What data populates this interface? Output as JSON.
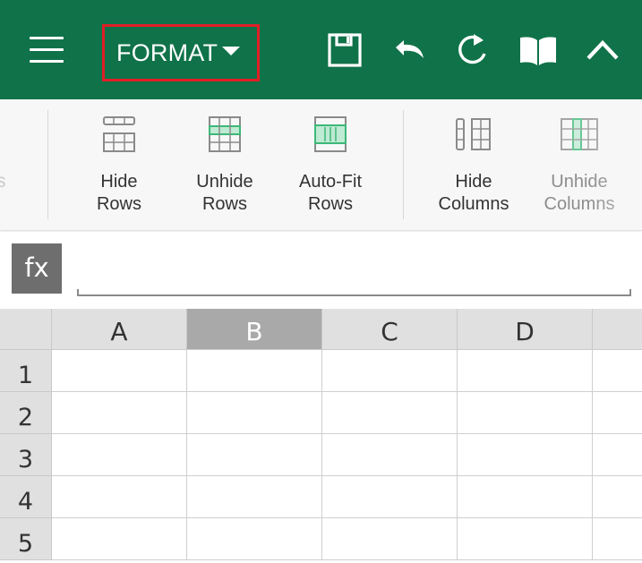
{
  "appbar": {
    "menu_icon": "hamburger-menu-icon",
    "format_label": "FORMAT",
    "format_caret_icon": "caret-down-icon",
    "actions": [
      {
        "name": "save-icon"
      },
      {
        "name": "undo-icon"
      },
      {
        "name": "redo-icon"
      },
      {
        "name": "reading-view-icon"
      },
      {
        "name": "collapse-ribbon-icon"
      }
    ],
    "bar_color": "#107249",
    "highlight_color": "#e01e26"
  },
  "ribbon": {
    "clipped_left_text": "s",
    "buttons": [
      {
        "label_line1": "Hide",
        "label_line2": "Rows",
        "icon": "hide-rows-icon"
      },
      {
        "label_line1": "Unhide",
        "label_line2": "Rows",
        "icon": "unhide-rows-icon"
      },
      {
        "label_line1": "Auto-Fit",
        "label_line2": "Rows",
        "icon": "autofit-rows-icon"
      },
      {
        "label_line1": "Hide",
        "label_line2": "Columns",
        "icon": "hide-columns-icon"
      },
      {
        "label_line1": "Unhide",
        "label_line2": "Columns",
        "icon": "unhide-columns-icon"
      }
    ],
    "icon_accent": "#3cb878"
  },
  "formula_bar": {
    "fx_label": "fx",
    "value": ""
  },
  "sheet": {
    "columns": [
      "A",
      "B",
      "C",
      "D"
    ],
    "selected_column": "B",
    "rows": [
      "1",
      "2",
      "3",
      "4",
      "5"
    ]
  }
}
